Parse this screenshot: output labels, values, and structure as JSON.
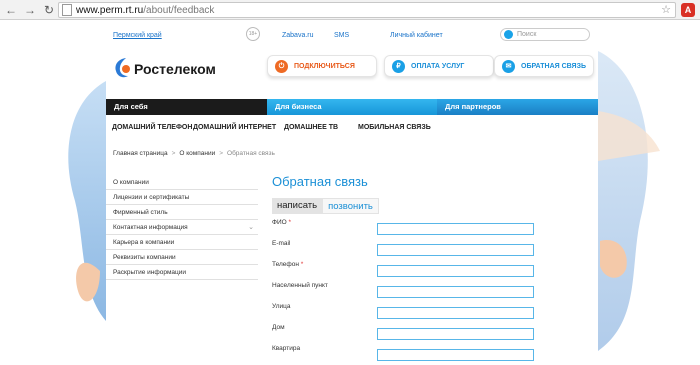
{
  "browser": {
    "url_host": "www.perm.rt.ru",
    "url_path": "/about/feedback",
    "ext_badge": "A"
  },
  "header": {
    "region": "Пермский край",
    "age_badge": "18+",
    "links": [
      "Zabava.ru",
      "SMS",
      "Личный кабинет"
    ],
    "search_placeholder": "Поиск",
    "logo_text": "Ростелеком",
    "buttons": {
      "connect": "ПОДКЛЮЧИТЬСЯ",
      "pay": "ОПЛАТА УСЛУГ",
      "feedback": "ОБРАТНАЯ СВЯЗЬ"
    }
  },
  "mainnav": [
    "Для себя",
    "Для бизнеса",
    "Для партнеров"
  ],
  "subnav": [
    "ДОМАШНИЙ ТЕЛЕФОН",
    "ДОМАШНИЙ ИНТЕРНЕТ",
    "ДОМАШНЕЕ ТВ",
    "МОБИЛЬНАЯ СВЯЗЬ"
  ],
  "breadcrumb": {
    "home": "Главная страница",
    "about": "О компании",
    "current": "Обратная связь"
  },
  "sidebar": [
    "О компании",
    "Лицензии и сертификаты",
    "Фирменный стиль",
    "Контактная информация",
    "Карьера в компании",
    "Реквизиты компании",
    "Раскрытие информации"
  ],
  "form": {
    "title": "Обратная связь",
    "tabs": [
      "написать",
      "позвонить"
    ],
    "fields": [
      {
        "label": "ФИО",
        "required": "*"
      },
      {
        "label": "E-mail",
        "required": ""
      },
      {
        "label": "Телефон",
        "required": "*"
      },
      {
        "label": "Населенный пункт",
        "required": ""
      },
      {
        "label": "Улица",
        "required": ""
      },
      {
        "label": "Дом",
        "required": ""
      },
      {
        "label": "Квартира",
        "required": ""
      }
    ]
  },
  "colors": {
    "accent": "#1c90d6",
    "orange": "#ee6a24",
    "nav_dark": "#1b1b1b"
  }
}
